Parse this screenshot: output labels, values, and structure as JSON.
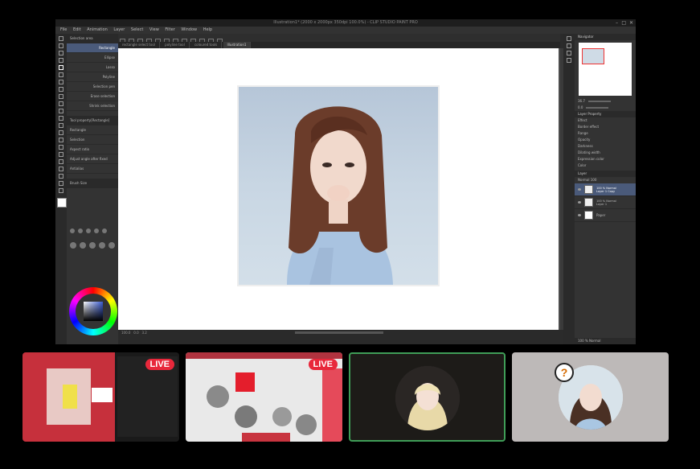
{
  "window": {
    "title": "Illustration1* (2000 x 2000px 350dpi 100.0%) - CLIP STUDIO PAINT PRO",
    "controls": [
      "–",
      "□",
      "✕"
    ]
  },
  "menu": [
    "File",
    "Edit",
    "Animation",
    "Layer",
    "Select",
    "View",
    "Filter",
    "Window",
    "Help"
  ],
  "tabs": [
    "rectangle select tool",
    "polyline tool",
    "coloured tools",
    "Illustration1"
  ],
  "subtool": {
    "header": "Selection area",
    "items": [
      "Rectangle",
      "Ellipse",
      "Lasso",
      "Polyline",
      "Selection pen",
      "Erase selection",
      "Shrink selection"
    ],
    "tool_property_header": "Tool property[Rectangle]",
    "tool_property_name": "Rectangle",
    "props": [
      "Selection",
      "Aspect ratio",
      "Adjust angle after fixed",
      "Antialias"
    ],
    "brush_size_header": "Brush Size"
  },
  "status": {
    "zoom": "100.0",
    "angle": "0.0",
    "coords": "3.2"
  },
  "navigator": {
    "header": "Navigator",
    "zoom": "36.7",
    "angle": "0.0"
  },
  "layer_property": {
    "header": "Layer Property",
    "effect_label": "Effect",
    "props": [
      "Border effect",
      "Range",
      "Opacity",
      "Darkness",
      "Dilating width",
      "Expression color"
    ],
    "expression_value": "Color"
  },
  "layers": {
    "header": "Layer",
    "blend_mode": "Normal",
    "opacity": "100",
    "items": [
      {
        "name": "100 % Normal\nLayer 1 Copy",
        "selected": true
      },
      {
        "name": "100 % Normal\nLayer 1",
        "selected": false
      },
      {
        "name": "Paper",
        "selected": false
      }
    ],
    "footer": "100 % Normal"
  },
  "participants": [
    {
      "live": true,
      "label": "LIVE"
    },
    {
      "live": true,
      "label": "LIVE"
    },
    {
      "live": false,
      "speaking": true
    },
    {
      "live": false,
      "badge": "?"
    }
  ]
}
